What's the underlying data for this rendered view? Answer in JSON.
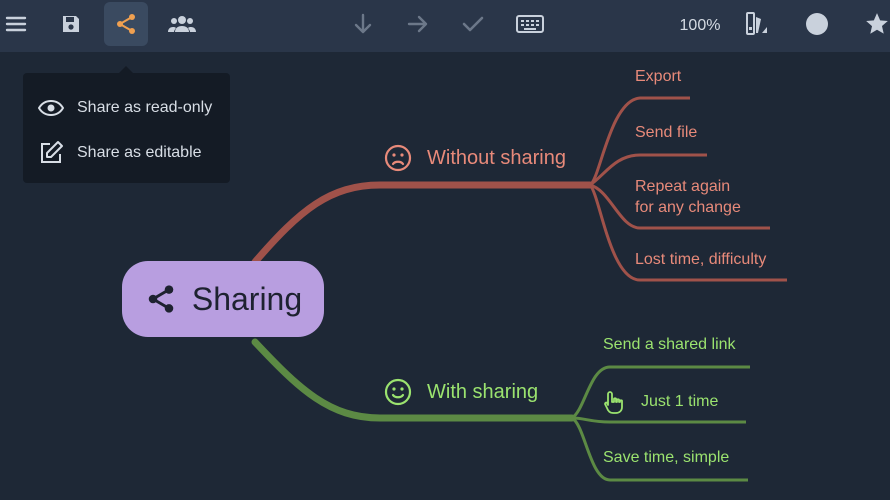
{
  "toolbar": {
    "zoom": "100%",
    "icons": [
      "menu-icon",
      "save-icon",
      "share-icon",
      "users-icon",
      "arrow-down-icon",
      "arrow-right-icon",
      "check-icon",
      "keyboard-icon",
      "style-icon",
      "circle-icon",
      "star-icon"
    ]
  },
  "share_menu": {
    "read_only": "Share as read-only",
    "editable": "Share as editable"
  },
  "mindmap": {
    "root": "Sharing",
    "without": {
      "label": "Without sharing",
      "items": [
        "Export",
        "Send file",
        "Repeat again\nfor any change",
        "Lost time, difficulty"
      ]
    },
    "with": {
      "label": "With sharing",
      "items": [
        "Send a shared link",
        "Just 1 time",
        "Save time, simple"
      ]
    }
  },
  "colors": {
    "background": "#1e2836",
    "toolbar": "#2a3649",
    "root": "#b89ee0",
    "without_branch": "#a0524a",
    "without_text": "#e88a7a",
    "with_branch": "#5c8a44",
    "with_text": "#9be36f",
    "accent": "#f0a050"
  }
}
